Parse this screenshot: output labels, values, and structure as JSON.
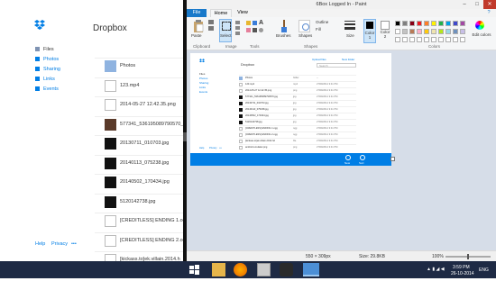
{
  "dropbox": {
    "title": "Dropbox",
    "nav": [
      {
        "label": "Files",
        "icon": "files-icon",
        "active": true
      },
      {
        "label": "Photos",
        "icon": "photos-icon",
        "active": false
      },
      {
        "label": "Sharing",
        "icon": "sharing-icon",
        "active": false
      },
      {
        "label": "Links",
        "icon": "links-icon",
        "active": false
      },
      {
        "label": "Events",
        "icon": "events-icon",
        "active": false
      }
    ],
    "footer": {
      "help": "Help",
      "privacy": "Privacy",
      "more": "•••"
    },
    "files": [
      {
        "name": "Photos",
        "thumb": "folder"
      },
      {
        "name": "123.mp4",
        "thumb": "video"
      },
      {
        "name": "2014-05-27 12.42.35.png",
        "thumb": "doc"
      },
      {
        "name": "577341_536195089790570_",
        "thumb": "photo"
      },
      {
        "name": "20130711_010703.jpg",
        "thumb": "dark"
      },
      {
        "name": "20140113_075238.jpg",
        "thumb": "dark"
      },
      {
        "name": "20140502_170434.jpg",
        "thumb": "dark"
      },
      {
        "name": "5120142738.jpg",
        "thumb": "dark"
      },
      {
        "name": "[CREDITLESS] ENDING 1.ogg",
        "thumb": "audio"
      },
      {
        "name": "[CREDITLESS] ENDING 2.ogg",
        "thumb": "audio"
      },
      {
        "name": "[kickass.to]ek.villain.2014.h",
        "thumb": "doc"
      },
      {
        "name": "android emulator.png",
        "thumb": "doc"
      }
    ]
  },
  "paint": {
    "window_title": "6Box Logged In - Paint",
    "tabs": {
      "file": "File",
      "home": "Home",
      "view": "View"
    },
    "ribbon": {
      "paste": "Paste",
      "select": "Select",
      "brushes": "Brushes",
      "shapes": "Shapes",
      "outline": "Outline",
      "fill": "Fill",
      "size": "Size",
      "color1": "Color 1",
      "color2": "Color 2",
      "edit_colors": "Edit colors",
      "text_tool": "A"
    },
    "groups": {
      "clipboard": "Clipboard",
      "image": "Image",
      "tools": "Tools",
      "shapes": "Shapes",
      "colors": "Colors"
    },
    "status": {
      "dimensions": "550 × 309px",
      "size": "Size: 29.8KB",
      "zoom": "100%"
    }
  },
  "palette": [
    "#000000",
    "#7f7f7f",
    "#880015",
    "#ed1c24",
    "#ff7f27",
    "#fff200",
    "#22b14c",
    "#00a2e8",
    "#3f48cc",
    "#a349a4",
    "#ffffff",
    "#c3c3c3",
    "#b97a57",
    "#ffaec9",
    "#ffc90e",
    "#efe4b0",
    "#b5e61d",
    "#99d9ea",
    "#7092be",
    "#c8bfe7"
  ],
  "taskbar": {
    "time": "3:59 PM",
    "date": "26-10-2014",
    "lang": "ENG"
  },
  "mini": {
    "title": "Dropbox",
    "upload": "Upload files",
    "new_folder": "New folder",
    "search": "Search",
    "nav": [
      "Files",
      "Photos",
      "Sharing",
      "Links",
      "Events"
    ],
    "rows": [
      {
        "name": "Photos",
        "kind": "folder",
        "mod": "--"
      },
      {
        "name": "123.mp4",
        "kind": "mp4",
        "mod": "27/09/2014 9:41 PM"
      },
      {
        "name": "2014-05-27 12.42.35.png",
        "kind": "png",
        "mod": "27/09/2014 9:41 PM"
      },
      {
        "name": "577341_536195089790570.jpg",
        "kind": "jpg",
        "mod": "27/09/2014 9:41 PM"
      },
      {
        "name": "20130711_010703.jpg",
        "kind": "jpg",
        "mod": "27/09/2014 9:41 PM"
      },
      {
        "name": "20140113_075238.jpg",
        "kind": "jpg",
        "mod": "27/09/2014 9:41 PM"
      },
      {
        "name": "20140502_170434.jpg",
        "kind": "jpg",
        "mod": "27/09/2014 9:41 PM"
      },
      {
        "name": "5120142738.jpg",
        "kind": "jpg",
        "mod": "27/09/2014 9:41 PM"
      },
      {
        "name": "[CREDITLESS] ENDING 1.ogg",
        "kind": "ogg",
        "mod": "27/09/2014 9:41 PM"
      },
      {
        "name": "[CREDITLESS] ENDING 2.ogg",
        "kind": "ogg",
        "mod": "27/09/2014 9:41 PM"
      },
      {
        "name": "[kickass.to]ek.villain.2014.hd",
        "kind": "file",
        "mod": "27/09/2014 9:41 PM"
      },
      {
        "name": "android emulator.png",
        "kind": "png",
        "mod": "27/09/2014 9:41 PM"
      }
    ],
    "footer_btns": [
      "New",
      "Sort"
    ],
    "footer_links": [
      "Help",
      "Privacy",
      "•••"
    ]
  },
  "colors": {
    "dropbox_blue": "#007ee5",
    "taskbar": "#1e2a44",
    "paint_file_tab": "#1979ca"
  }
}
